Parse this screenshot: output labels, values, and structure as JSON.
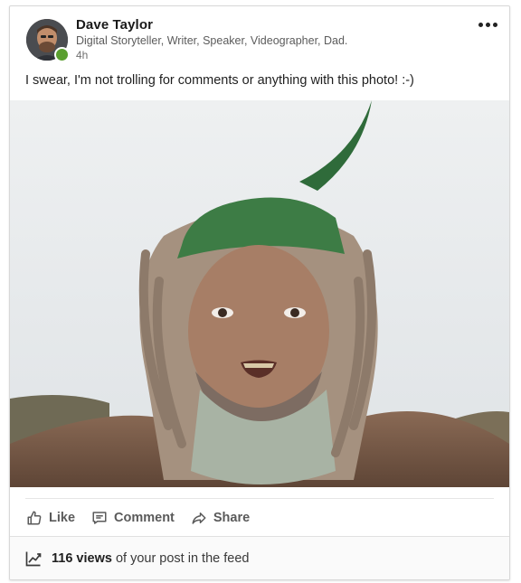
{
  "post": {
    "author": {
      "name": "Dave Taylor",
      "headline": "Digital Storyteller, Writer, Speaker, Videographer, Dad.",
      "time": "4h",
      "online": true
    },
    "text": "I swear, I'm not trolling for comments or anything with this photo! :-)",
    "image_icon": "selfie-photo"
  },
  "actions": {
    "like_label": "Like",
    "comment_label": "Comment",
    "share_label": "Share"
  },
  "stats": {
    "views_count": "116 views",
    "views_suffix": " of your post in the feed"
  },
  "colors": {
    "presence": "#5a9f2f",
    "text_secondary": "#5b5b5b",
    "action_text": "#5a5a5a"
  }
}
